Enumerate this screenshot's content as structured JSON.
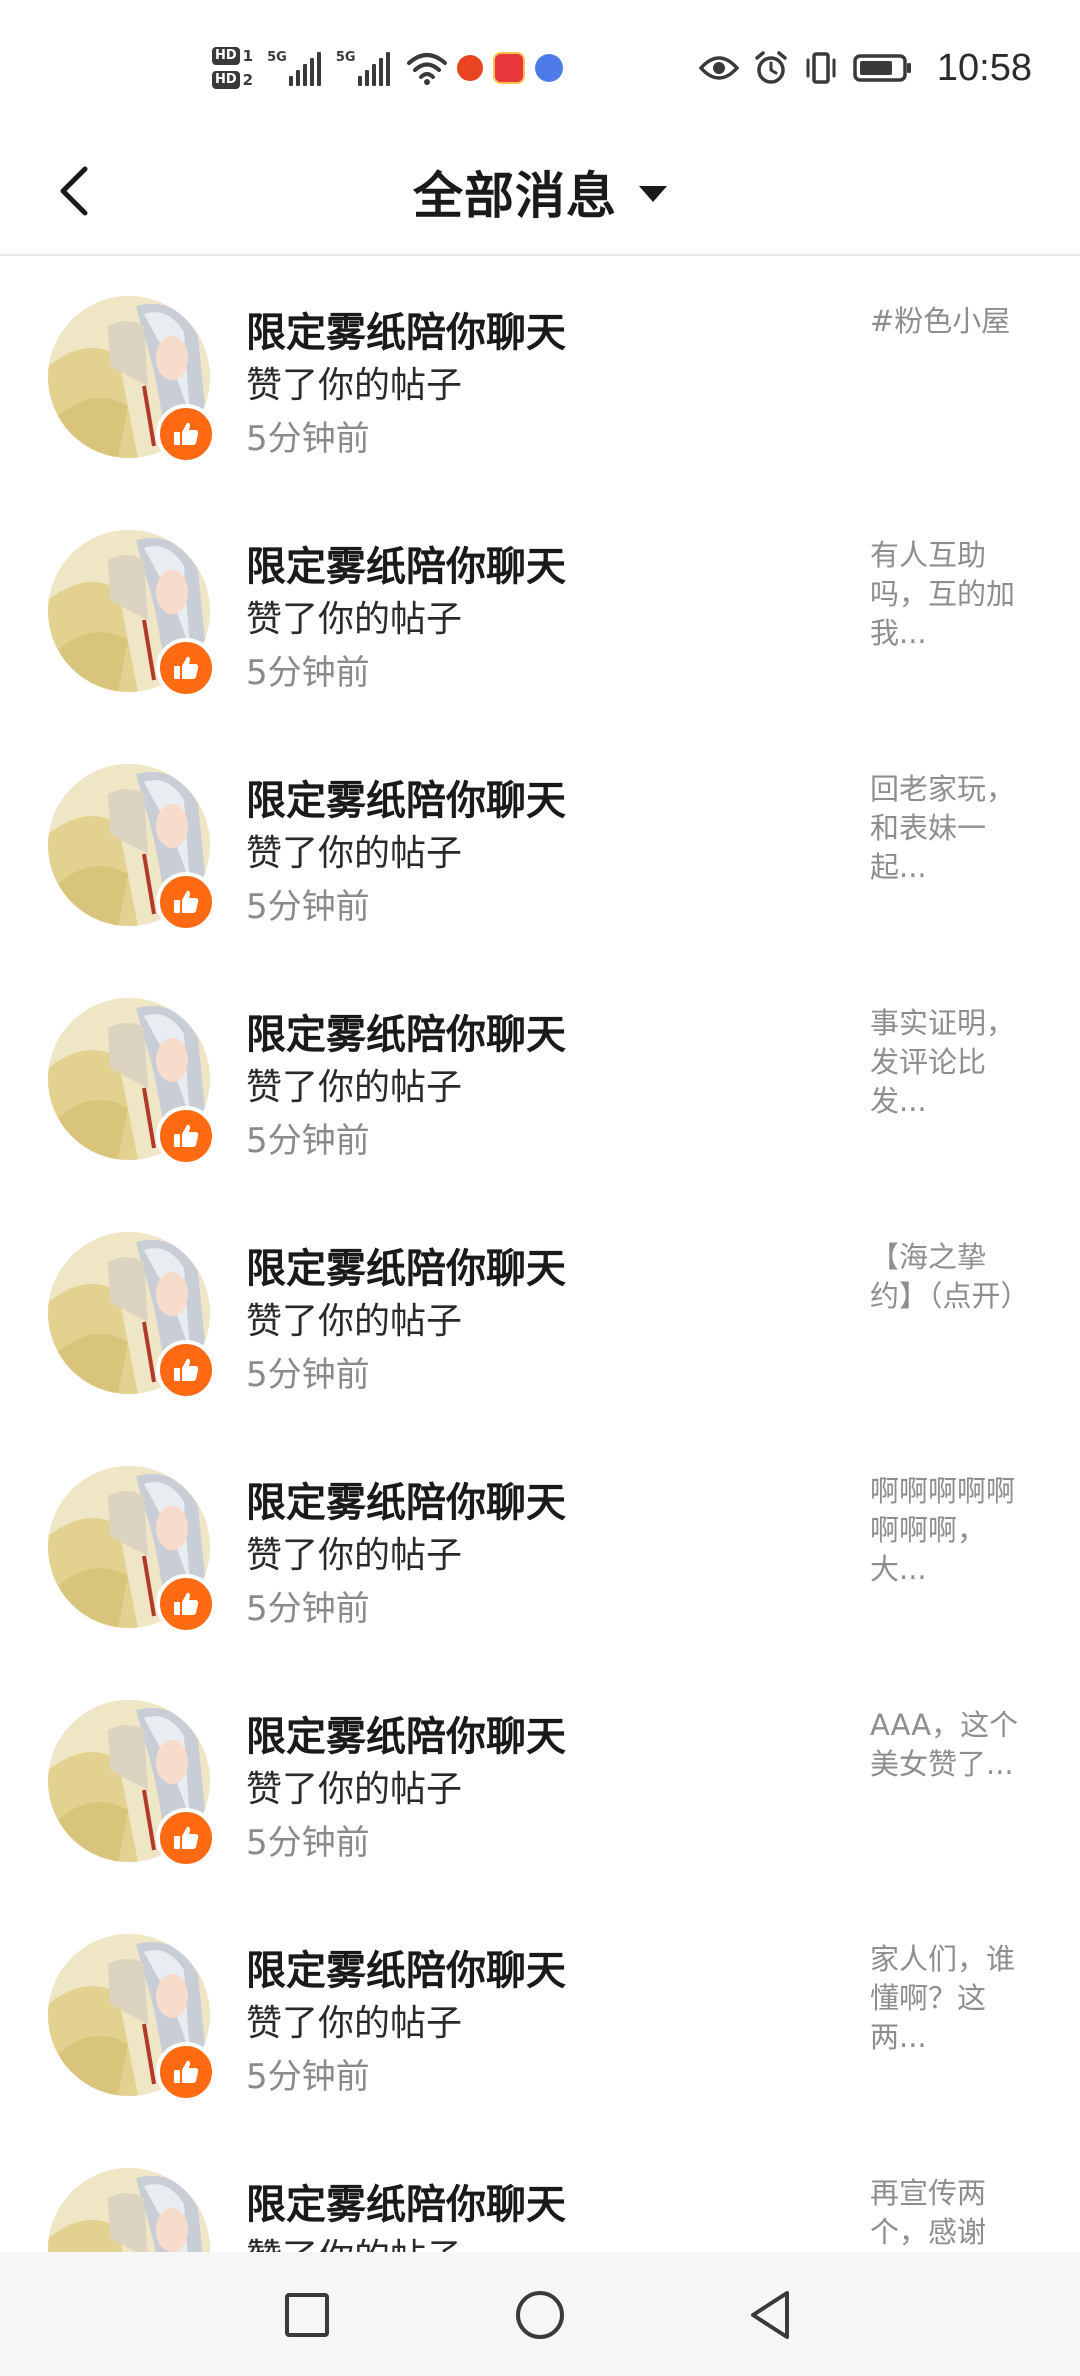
{
  "status_bar": {
    "time": "10:58",
    "sim1_label": "HD",
    "sim1_slot": "1",
    "sim2_label": "HD",
    "sim2_slot": "2",
    "network1": "5G",
    "network2": "5G",
    "battery_level": 0.8,
    "icons": [
      "hd-sim-icon",
      "signal-icon",
      "wifi-icon",
      "app-notification-icon",
      "eye-comfort-icon",
      "alarm-icon",
      "vibrate-icon",
      "battery-icon"
    ]
  },
  "header": {
    "title": "全部消息",
    "back_icon": "chevron-left-icon",
    "dropdown_icon": "caret-down-icon"
  },
  "accent_color": "#ff6a13",
  "messages": [
    {
      "name": "限定雾纸陪你聊天",
      "action": "赞了你的帖子",
      "time": "5分钟前",
      "snippet": "#粉色小屋"
    },
    {
      "name": "限定雾纸陪你聊天",
      "action": "赞了你的帖子",
      "time": "5分钟前",
      "snippet": "有人互助吗，互的加我..."
    },
    {
      "name": "限定雾纸陪你聊天",
      "action": "赞了你的帖子",
      "time": "5分钟前",
      "snippet": "回老家玩，和表妹一起..."
    },
    {
      "name": "限定雾纸陪你聊天",
      "action": "赞了你的帖子",
      "time": "5分钟前",
      "snippet": "事实证明，发评论比发..."
    },
    {
      "name": "限定雾纸陪你聊天",
      "action": "赞了你的帖子",
      "time": "5分钟前",
      "snippet": "【海之挚约】（点开）"
    },
    {
      "name": "限定雾纸陪你聊天",
      "action": "赞了你的帖子",
      "time": "5分钟前",
      "snippet": "啊啊啊啊啊啊啊啊，大..."
    },
    {
      "name": "限定雾纸陪你聊天",
      "action": "赞了你的帖子",
      "time": "5分钟前",
      "snippet": "AAA，这个美女赞了..."
    },
    {
      "name": "限定雾纸陪你聊天",
      "action": "赞了你的帖子",
      "time": "5分钟前",
      "snippet": "家人们，谁懂啊？这两..."
    },
    {
      "name": "限定雾纸陪你聊天",
      "action": "赞了你的帖子",
      "time": "",
      "snippet": "再宣传两个，感谢"
    }
  ],
  "nav_bar": {
    "buttons": [
      "recent-apps-icon",
      "home-icon",
      "back-triangle-icon"
    ]
  }
}
